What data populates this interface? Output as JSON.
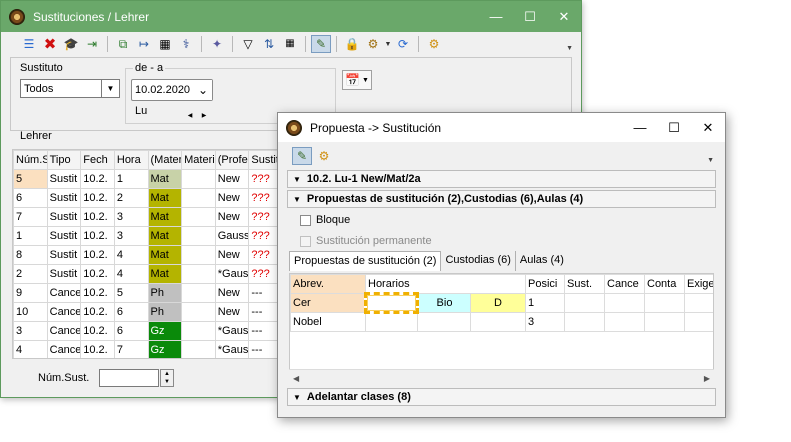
{
  "win1": {
    "title": "Sustituciones / Lehrer",
    "toolbar_icons": [
      "list-icon",
      "delete-icon",
      "graduation-cap-icon",
      "import-icon",
      "copy-icon",
      "export-icon",
      "calculator-icon",
      "stethoscope-icon",
      "wand-icon",
      "filter-icon",
      "sort-icon",
      "grid-icon",
      "edit-icon",
      "lock-icon",
      "settings-gear-icon",
      "refresh-icon",
      "gear-icon"
    ],
    "filters": {
      "sustituto_label": "Sustituto",
      "sustituto_value": "Todos",
      "range_label": "de - a",
      "date_value": "10.02.2020",
      "weekday": "Lu"
    },
    "section_label": "Lehrer",
    "table": {
      "headers": [
        "Núm.S",
        "Tipo",
        "Fech",
        "Hora",
        "(Mater",
        "Materi",
        "(Profe",
        "Sustit"
      ],
      "rows": [
        [
          "5",
          "Sustit",
          "10.2.",
          "1",
          "Mat",
          "",
          "New",
          "???"
        ],
        [
          "6",
          "Sustit",
          "10.2.",
          "2",
          "Mat",
          "",
          "New",
          "???"
        ],
        [
          "7",
          "Sustit",
          "10.2.",
          "3",
          "Mat",
          "",
          "New",
          "???"
        ],
        [
          "1",
          "Sustit",
          "10.2.",
          "3",
          "Mat",
          "",
          "Gauss",
          "???"
        ],
        [
          "8",
          "Sustit",
          "10.2.",
          "4",
          "Mat",
          "",
          "New",
          "???"
        ],
        [
          "2",
          "Sustit",
          "10.2.",
          "4",
          "Mat",
          "",
          "*Gaus",
          "???"
        ],
        [
          "9",
          "Cance",
          "10.2.",
          "5",
          "Ph",
          "",
          "New",
          "---"
        ],
        [
          "10",
          "Cance",
          "10.2.",
          "6",
          "Ph",
          "",
          "New",
          "---"
        ],
        [
          "3",
          "Cance",
          "10.2.",
          "6",
          "Gz",
          "",
          "*Gaus",
          "---"
        ],
        [
          "4",
          "Cance",
          "10.2.",
          "7",
          "Gz",
          "",
          "*Gaus",
          "---"
        ]
      ]
    },
    "footer_label": "Núm.Sust.",
    "footer_value": ""
  },
  "win2": {
    "title": "Propuesta -> Sustitución",
    "toolbar_icons": [
      "edit-icon",
      "gear-icon"
    ],
    "section1": "10.2. Lu-1 New/Mat/2a",
    "section2": "Propuestas de sustitución (2),Custodias (6),Aulas (4)",
    "check_bloque": "Bloque",
    "check_permanente": "Sustitución permanente",
    "tabs": [
      "Propuestas de sustitución (2)",
      "Custodias (6)",
      "Aulas (4)"
    ],
    "table": {
      "headers": [
        "Abrev.",
        "Horarios",
        "",
        "",
        "Posici",
        "Sust.",
        "Cance",
        "Conta",
        "Exige"
      ],
      "rows": [
        [
          "Cer",
          "",
          "Bio",
          "D",
          "1",
          "",
          "",
          "",
          ""
        ],
        [
          "Nobel",
          "",
          "",
          "",
          "3",
          "",
          "",
          "",
          ""
        ]
      ]
    },
    "section3": "Adelantar clases (8)"
  },
  "colors": {
    "win1_title_bg": "#6aa86a",
    "mat_cell": "#b4b400",
    "ph_cell": "#c0c0c0",
    "gz_cell": "#0a8a0a",
    "selected_row": "#fbe0c0",
    "alert_text": "#e00000",
    "selection_dash": "#f0b000",
    "bio_cell": "#ccffff",
    "d_cell": "#ffff99"
  }
}
